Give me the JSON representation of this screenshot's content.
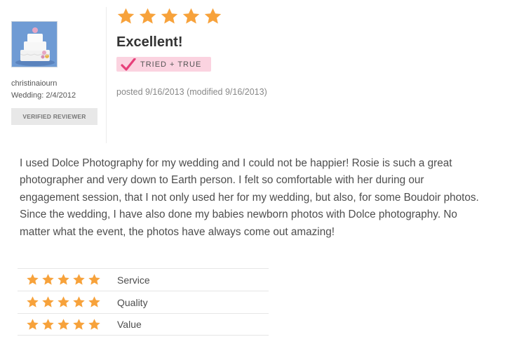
{
  "review": {
    "rating_overall": 5,
    "title": "Excellent!",
    "badge_label": "TRIED + TRUE",
    "posted": "posted 9/16/2013 (modified 9/16/2013)",
    "body": "I used Dolce Photography for my wedding and I could not be happier! Rosie is such a great photographer and very down to Earth person. I felt so comfortable with her during our engagement session, that I not only used her for my wedding, but also, for some Boudoir photos. Since the wedding, I have also done my babies newborn photos with Dolce photography. No matter what the event, the photos have always come out amazing!"
  },
  "reviewer": {
    "name": "christinaiourn",
    "wedding": "Wedding: 2/4/2012",
    "verified_label": "VERIFIED REVIEWER",
    "avatar_icon": "wedding-cake-icon"
  },
  "sub_ratings": [
    {
      "label": "Service",
      "stars": 5
    },
    {
      "label": "Quality",
      "stars": 5
    },
    {
      "label": "Value",
      "stars": 5
    }
  ],
  "colors": {
    "star": "#f7a23b",
    "badge_bg": "#fbd3e0",
    "check": "#e6407a",
    "verified_bg": "#e8e8e8"
  },
  "icons": {
    "star": "star-icon",
    "check": "checkmark-icon"
  }
}
